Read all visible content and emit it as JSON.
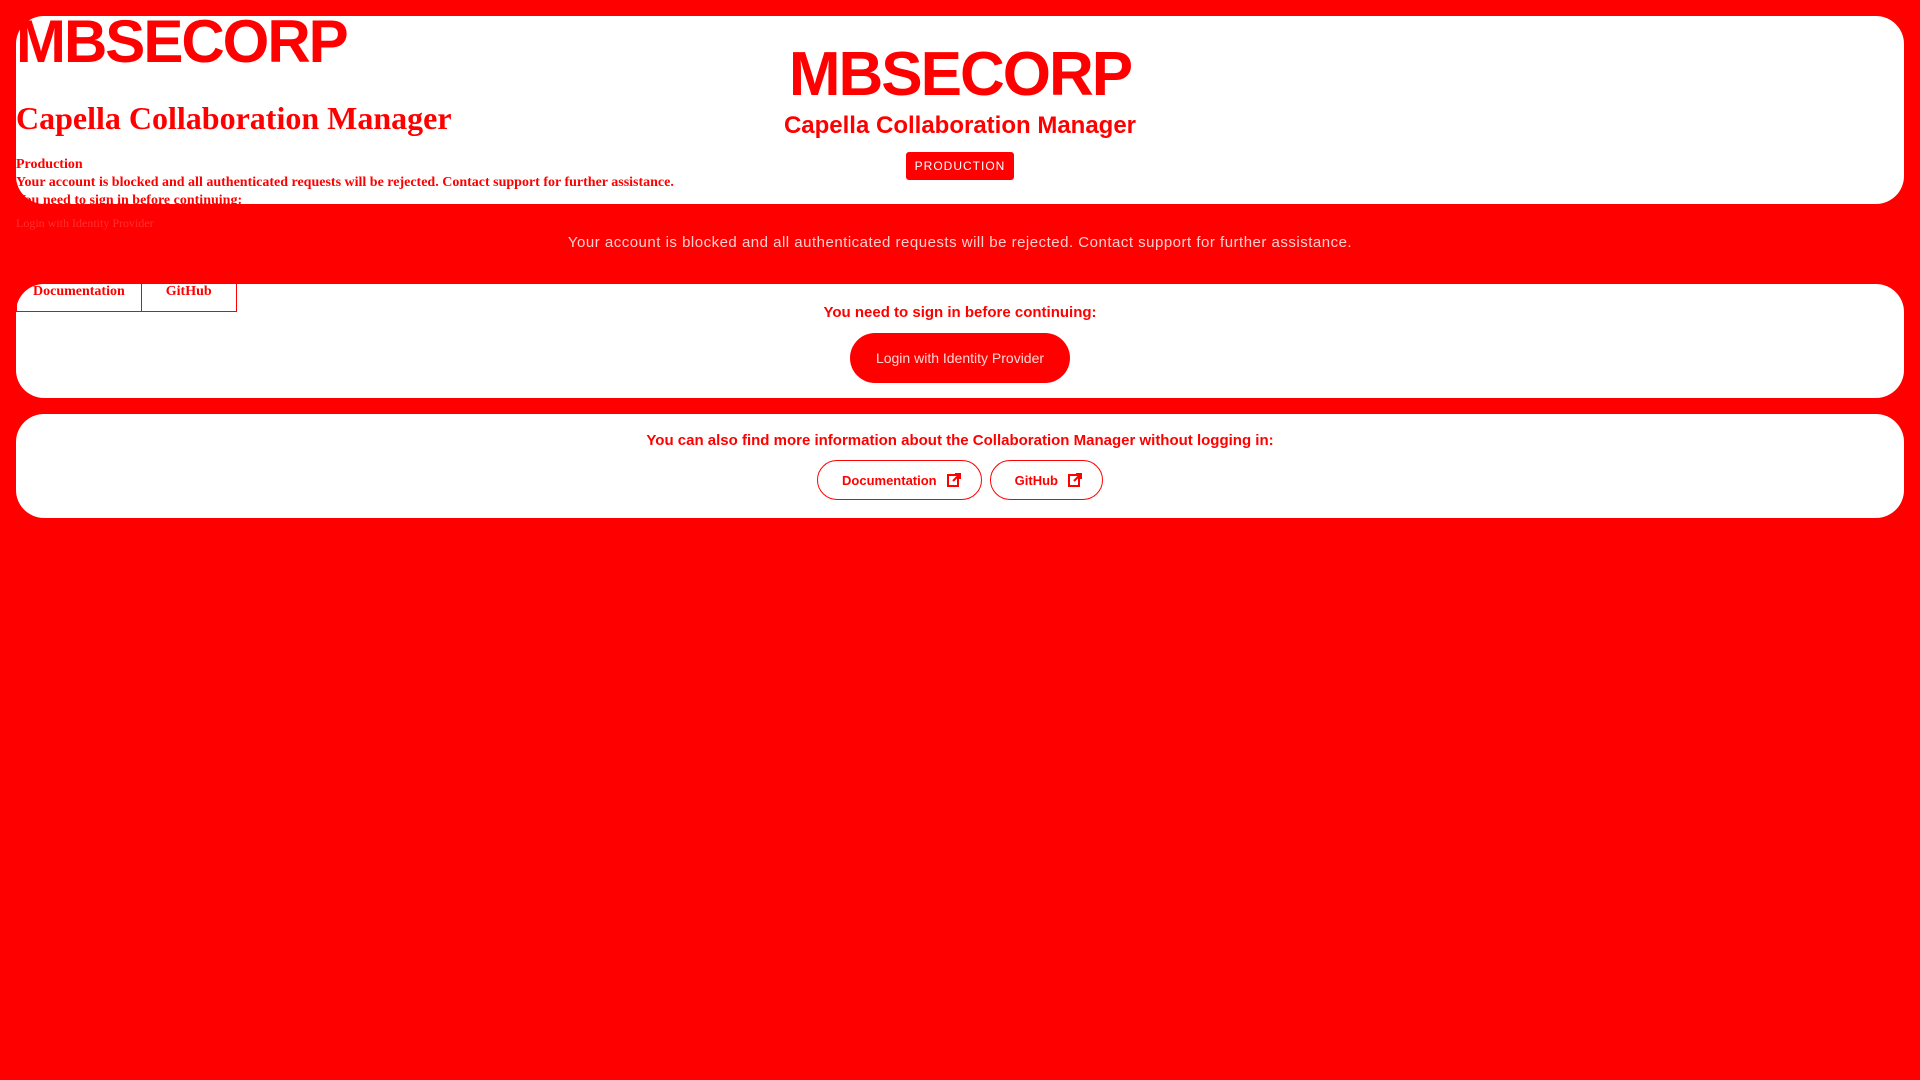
{
  "brand": {
    "logo": "MBSECORP",
    "title": "Capella Collaboration Manager",
    "environment": "PRODUCTION"
  },
  "raw": {
    "logo": "MBSECORP",
    "title": "Capella Collaboration Manager",
    "environment": "Production",
    "blocked": "Your account is blocked and all authenticated requests will be rejected. Contact support for further assistance.",
    "sign_in": "You need to sign in before continuing:",
    "login_button": "Login with Identity Provider",
    "documentation": "Documentation",
    "github": "GitHub"
  },
  "alert": {
    "blocked": "Your account is blocked and all authenticated requests will be rejected. Contact support for further assistance."
  },
  "login": {
    "heading": "You need to sign in before continuing:",
    "button_label": "Login with Identity Provider"
  },
  "info": {
    "heading": "You can also find more information about the Collaboration Manager without logging in:",
    "links": [
      {
        "label": "Documentation",
        "icon": "external-link-icon"
      },
      {
        "label": "GitHub",
        "icon": "external-link-icon"
      }
    ]
  },
  "colors": {
    "background": "#ff0000",
    "card": "#ffffff",
    "accent": "#ff0000"
  }
}
